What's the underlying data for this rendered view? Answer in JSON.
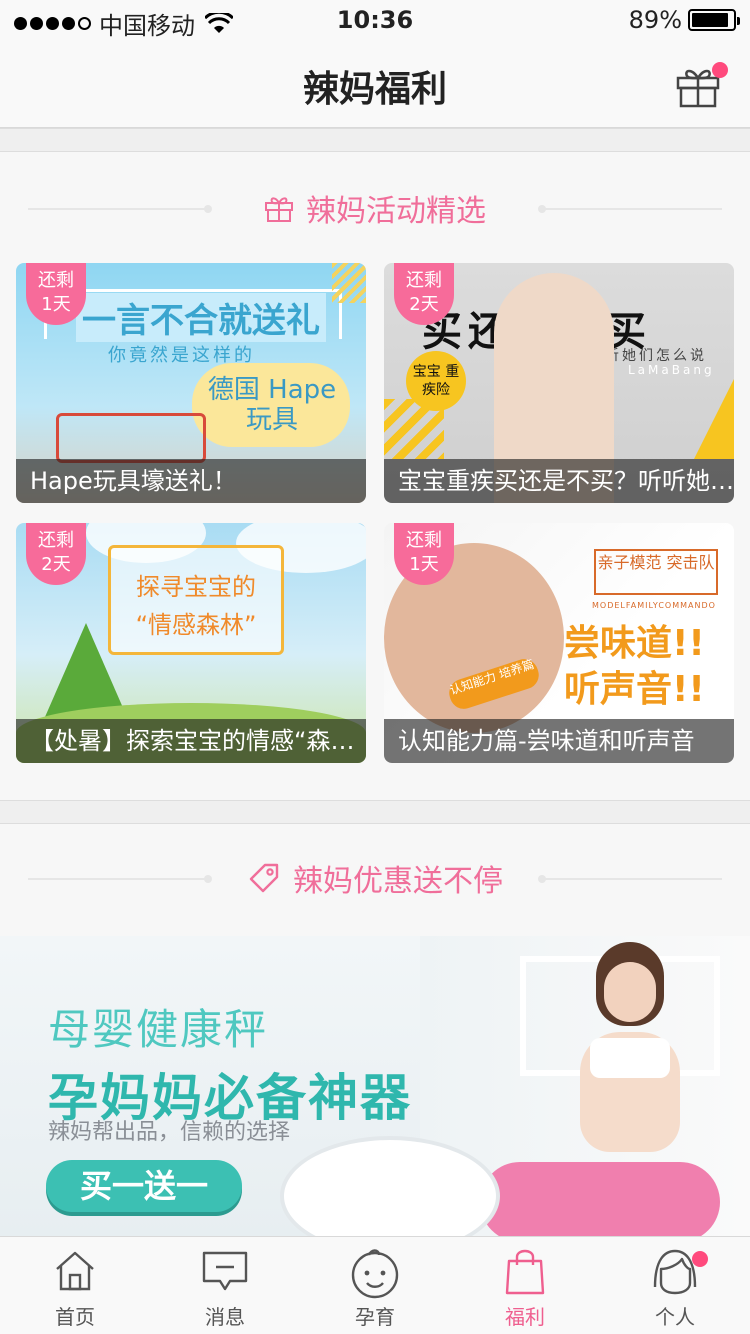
{
  "status_bar": {
    "carrier": "中国移动",
    "time": "10:36",
    "battery": "89%",
    "battery_level": 0.89,
    "signal_bars_filled": 4
  },
  "navbar": {
    "title": "辣妈福利",
    "gift_icon": "gift-icon"
  },
  "activities": {
    "header": "辣妈活动精选",
    "cards": [
      {
        "remain_top": "还剩",
        "remain_bottom": "1天",
        "caption": "Hape玩具壕送礼！",
        "art_title": "一言不合就送礼",
        "art_subtitle": "你竟然是这样的",
        "art_badge": "德国 Hape玩具"
      },
      {
        "remain_top": "还剩",
        "remain_bottom": "2天",
        "caption": "宝宝重疾买还是不买？听听她们怎么说",
        "art_title": "买还是不买",
        "art_subtitle": "听听她们怎么说",
        "art_badge": "宝宝 重疾险",
        "art_watermark": "LaMaBang"
      },
      {
        "remain_top": "还剩",
        "remain_bottom": "2天",
        "caption": "【处暑】探索宝宝的情感“森林”",
        "art_title": "探寻宝宝的",
        "art_subtitle": "“情感森林”"
      },
      {
        "remain_top": "还剩",
        "remain_bottom": "1天",
        "caption": "认知能力篇-尝味道和听声音",
        "art_title": "亲子模范 突击队",
        "art_subtitle": "MODELFAMILYCOMMANDO",
        "art_badge": "尝味道!! 听声音!!",
        "art_tag": "认知能力 培养篇"
      }
    ]
  },
  "deals": {
    "header": "辣妈优惠送不停",
    "banner": {
      "line1": "母婴健康秤",
      "line2": "孕妈妈必备神器",
      "line3": "辣妈帮出品，信赖的选择",
      "button": "买一送一"
    }
  },
  "tabbar": {
    "items": [
      {
        "label": "首页",
        "icon": "home-icon"
      },
      {
        "label": "消息",
        "icon": "message-icon"
      },
      {
        "label": "孕育",
        "icon": "baby-face-icon"
      },
      {
        "label": "福利",
        "icon": "shopping-bag-icon",
        "active": true
      },
      {
        "label": "个人",
        "icon": "person-icon"
      }
    ]
  },
  "colors": {
    "accent": "#f06e9a",
    "active_tab": "#ef5f8f",
    "badge": "#ff4a7d",
    "teal": "#3cc0b3"
  }
}
